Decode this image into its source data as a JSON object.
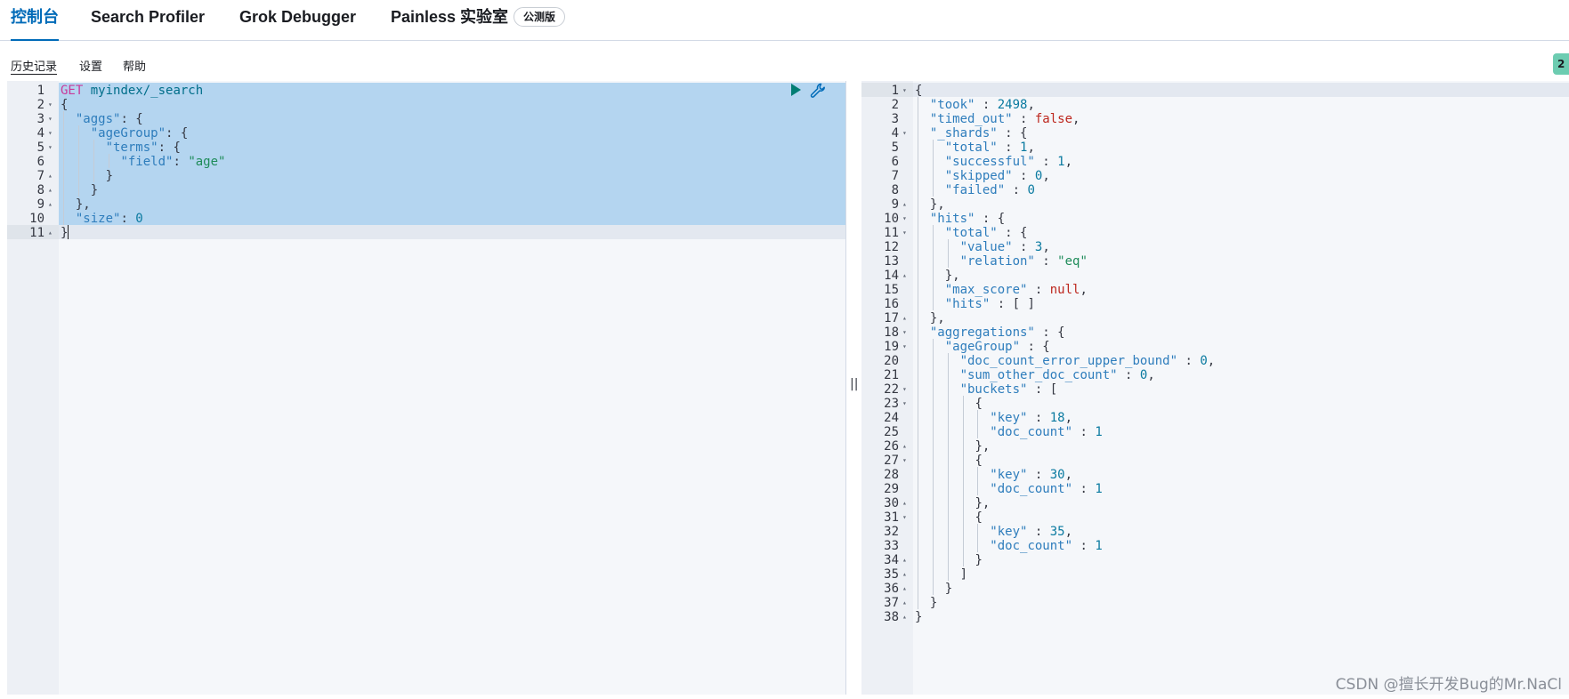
{
  "tabs": [
    {
      "label": "控制台",
      "active": true
    },
    {
      "label": "Search Profiler",
      "active": false
    },
    {
      "label": "Grok Debugger",
      "active": false
    },
    {
      "label": "Painless 实验室",
      "active": false,
      "badge": "公测版"
    }
  ],
  "toolbar": {
    "history": "历史记录",
    "settings": "设置",
    "help": "帮助",
    "status_badge": "2"
  },
  "colors": {
    "accent": "#006bb8",
    "selection": "#b4d5f0",
    "status_ok": "#6dccb1",
    "run_button": "#017d73"
  },
  "request_editor": {
    "selected_lines": [
      1,
      10
    ],
    "active_line": 11,
    "lines": [
      {
        "n": "1",
        "fold": "",
        "indent": 0,
        "tokens": [
          [
            "m",
            "GET"
          ],
          [
            "p",
            " "
          ],
          [
            "u",
            "myindex/_search"
          ]
        ]
      },
      {
        "n": "2",
        "fold": "▾",
        "indent": 0,
        "tokens": [
          [
            "p",
            "{"
          ]
        ]
      },
      {
        "n": "3",
        "fold": "▾",
        "indent": 1,
        "tokens": [
          [
            "k",
            "\"aggs\""
          ],
          [
            "p",
            ": {"
          ]
        ]
      },
      {
        "n": "4",
        "fold": "▾",
        "indent": 2,
        "tokens": [
          [
            "k",
            "\"ageGroup\""
          ],
          [
            "p",
            ": {"
          ]
        ]
      },
      {
        "n": "5",
        "fold": "▾",
        "indent": 3,
        "tokens": [
          [
            "k",
            "\"terms\""
          ],
          [
            "p",
            ": {"
          ]
        ]
      },
      {
        "n": "6",
        "fold": "",
        "indent": 4,
        "tokens": [
          [
            "k",
            "\"field\""
          ],
          [
            "p",
            ": "
          ],
          [
            "s",
            "\"age\""
          ]
        ]
      },
      {
        "n": "7",
        "fold": "▴",
        "indent": 3,
        "tokens": [
          [
            "p",
            "}"
          ]
        ]
      },
      {
        "n": "8",
        "fold": "▴",
        "indent": 2,
        "tokens": [
          [
            "p",
            "}"
          ]
        ]
      },
      {
        "n": "9",
        "fold": "▴",
        "indent": 1,
        "tokens": [
          [
            "p",
            "},"
          ]
        ]
      },
      {
        "n": "10",
        "fold": "",
        "indent": 1,
        "tokens": [
          [
            "k",
            "\"size\""
          ],
          [
            "p",
            ": "
          ],
          [
            "n",
            "0"
          ]
        ]
      },
      {
        "n": "11",
        "fold": "▴",
        "indent": 0,
        "tokens": [
          [
            "p",
            "}"
          ]
        ]
      }
    ]
  },
  "response_editor": {
    "active_line": 1,
    "lines": [
      {
        "n": "1",
        "fold": "▾",
        "indent": 0,
        "tokens": [
          [
            "p",
            "{"
          ]
        ]
      },
      {
        "n": "2",
        "fold": "",
        "indent": 1,
        "tokens": [
          [
            "k",
            "\"took\""
          ],
          [
            "p",
            " : "
          ],
          [
            "n",
            "2498"
          ],
          [
            "p",
            ","
          ]
        ]
      },
      {
        "n": "3",
        "fold": "",
        "indent": 1,
        "tokens": [
          [
            "k",
            "\"timed_out\""
          ],
          [
            "p",
            " : "
          ],
          [
            "b",
            "false"
          ],
          [
            "p",
            ","
          ]
        ]
      },
      {
        "n": "4",
        "fold": "▾",
        "indent": 1,
        "tokens": [
          [
            "k",
            "\"_shards\""
          ],
          [
            "p",
            " : {"
          ]
        ]
      },
      {
        "n": "5",
        "fold": "",
        "indent": 2,
        "tokens": [
          [
            "k",
            "\"total\""
          ],
          [
            "p",
            " : "
          ],
          [
            "n",
            "1"
          ],
          [
            "p",
            ","
          ]
        ]
      },
      {
        "n": "6",
        "fold": "",
        "indent": 2,
        "tokens": [
          [
            "k",
            "\"successful\""
          ],
          [
            "p",
            " : "
          ],
          [
            "n",
            "1"
          ],
          [
            "p",
            ","
          ]
        ]
      },
      {
        "n": "7",
        "fold": "",
        "indent": 2,
        "tokens": [
          [
            "k",
            "\"skipped\""
          ],
          [
            "p",
            " : "
          ],
          [
            "n",
            "0"
          ],
          [
            "p",
            ","
          ]
        ]
      },
      {
        "n": "8",
        "fold": "",
        "indent": 2,
        "tokens": [
          [
            "k",
            "\"failed\""
          ],
          [
            "p",
            " : "
          ],
          [
            "n",
            "0"
          ]
        ]
      },
      {
        "n": "9",
        "fold": "▴",
        "indent": 1,
        "tokens": [
          [
            "p",
            "},"
          ]
        ]
      },
      {
        "n": "10",
        "fold": "▾",
        "indent": 1,
        "tokens": [
          [
            "k",
            "\"hits\""
          ],
          [
            "p",
            " : {"
          ]
        ]
      },
      {
        "n": "11",
        "fold": "▾",
        "indent": 2,
        "tokens": [
          [
            "k",
            "\"total\""
          ],
          [
            "p",
            " : {"
          ]
        ]
      },
      {
        "n": "12",
        "fold": "",
        "indent": 3,
        "tokens": [
          [
            "k",
            "\"value\""
          ],
          [
            "p",
            " : "
          ],
          [
            "n",
            "3"
          ],
          [
            "p",
            ","
          ]
        ]
      },
      {
        "n": "13",
        "fold": "",
        "indent": 3,
        "tokens": [
          [
            "k",
            "\"relation\""
          ],
          [
            "p",
            " : "
          ],
          [
            "s",
            "\"eq\""
          ]
        ]
      },
      {
        "n": "14",
        "fold": "▴",
        "indent": 2,
        "tokens": [
          [
            "p",
            "},"
          ]
        ]
      },
      {
        "n": "15",
        "fold": "",
        "indent": 2,
        "tokens": [
          [
            "k",
            "\"max_score\""
          ],
          [
            "p",
            " : "
          ],
          [
            "b",
            "null"
          ],
          [
            "p",
            ","
          ]
        ]
      },
      {
        "n": "16",
        "fold": "",
        "indent": 2,
        "tokens": [
          [
            "k",
            "\"hits\""
          ],
          [
            "p",
            " : [ ]"
          ]
        ]
      },
      {
        "n": "17",
        "fold": "▴",
        "indent": 1,
        "tokens": [
          [
            "p",
            "},"
          ]
        ]
      },
      {
        "n": "18",
        "fold": "▾",
        "indent": 1,
        "tokens": [
          [
            "k",
            "\"aggregations\""
          ],
          [
            "p",
            " : {"
          ]
        ]
      },
      {
        "n": "19",
        "fold": "▾",
        "indent": 2,
        "tokens": [
          [
            "k",
            "\"ageGroup\""
          ],
          [
            "p",
            " : {"
          ]
        ]
      },
      {
        "n": "20",
        "fold": "",
        "indent": 3,
        "tokens": [
          [
            "k",
            "\"doc_count_error_upper_bound\""
          ],
          [
            "p",
            " : "
          ],
          [
            "n",
            "0"
          ],
          [
            "p",
            ","
          ]
        ]
      },
      {
        "n": "21",
        "fold": "",
        "indent": 3,
        "tokens": [
          [
            "k",
            "\"sum_other_doc_count\""
          ],
          [
            "p",
            " : "
          ],
          [
            "n",
            "0"
          ],
          [
            "p",
            ","
          ]
        ]
      },
      {
        "n": "22",
        "fold": "▾",
        "indent": 3,
        "tokens": [
          [
            "k",
            "\"buckets\""
          ],
          [
            "p",
            " : ["
          ]
        ]
      },
      {
        "n": "23",
        "fold": "▾",
        "indent": 4,
        "tokens": [
          [
            "p",
            "{"
          ]
        ]
      },
      {
        "n": "24",
        "fold": "",
        "indent": 5,
        "tokens": [
          [
            "k",
            "\"key\""
          ],
          [
            "p",
            " : "
          ],
          [
            "n",
            "18"
          ],
          [
            "p",
            ","
          ]
        ]
      },
      {
        "n": "25",
        "fold": "",
        "indent": 5,
        "tokens": [
          [
            "k",
            "\"doc_count\""
          ],
          [
            "p",
            " : "
          ],
          [
            "n",
            "1"
          ]
        ]
      },
      {
        "n": "26",
        "fold": "▴",
        "indent": 4,
        "tokens": [
          [
            "p",
            "},"
          ]
        ]
      },
      {
        "n": "27",
        "fold": "▾",
        "indent": 4,
        "tokens": [
          [
            "p",
            "{"
          ]
        ]
      },
      {
        "n": "28",
        "fold": "",
        "indent": 5,
        "tokens": [
          [
            "k",
            "\"key\""
          ],
          [
            "p",
            " : "
          ],
          [
            "n",
            "30"
          ],
          [
            "p",
            ","
          ]
        ]
      },
      {
        "n": "29",
        "fold": "",
        "indent": 5,
        "tokens": [
          [
            "k",
            "\"doc_count\""
          ],
          [
            "p",
            " : "
          ],
          [
            "n",
            "1"
          ]
        ]
      },
      {
        "n": "30",
        "fold": "▴",
        "indent": 4,
        "tokens": [
          [
            "p",
            "},"
          ]
        ]
      },
      {
        "n": "31",
        "fold": "▾",
        "indent": 4,
        "tokens": [
          [
            "p",
            "{"
          ]
        ]
      },
      {
        "n": "32",
        "fold": "",
        "indent": 5,
        "tokens": [
          [
            "k",
            "\"key\""
          ],
          [
            "p",
            " : "
          ],
          [
            "n",
            "35"
          ],
          [
            "p",
            ","
          ]
        ]
      },
      {
        "n": "33",
        "fold": "",
        "indent": 5,
        "tokens": [
          [
            "k",
            "\"doc_count\""
          ],
          [
            "p",
            " : "
          ],
          [
            "n",
            "1"
          ]
        ]
      },
      {
        "n": "34",
        "fold": "▴",
        "indent": 4,
        "tokens": [
          [
            "p",
            "}"
          ]
        ]
      },
      {
        "n": "35",
        "fold": "▴",
        "indent": 3,
        "tokens": [
          [
            "p",
            "]"
          ]
        ]
      },
      {
        "n": "36",
        "fold": "▴",
        "indent": 2,
        "tokens": [
          [
            "p",
            "}"
          ]
        ]
      },
      {
        "n": "37",
        "fold": "▴",
        "indent": 1,
        "tokens": [
          [
            "p",
            "}"
          ]
        ]
      },
      {
        "n": "38",
        "fold": "▴",
        "indent": 0,
        "tokens": [
          [
            "p",
            "}"
          ]
        ]
      }
    ]
  },
  "resizer_glyph": "||",
  "watermark": "CSDN @擅长开发Bug的Mr.NaCl"
}
